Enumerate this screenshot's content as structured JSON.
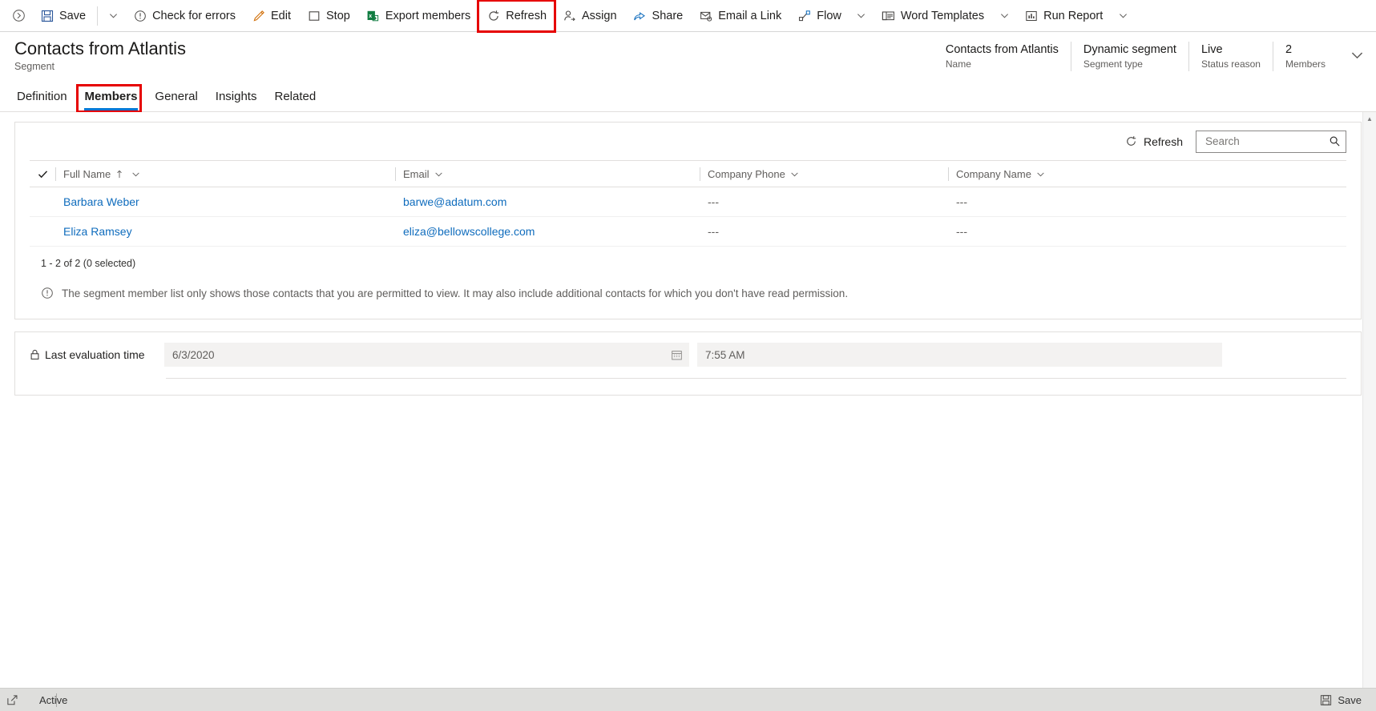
{
  "commandbar": {
    "expand_icon": "chevron-right-circle-icon",
    "items": [
      {
        "label": "Save",
        "icon": "save-icon",
        "caret": true
      },
      {
        "label": "Check for errors",
        "icon": "error-circle-icon",
        "caret": false
      },
      {
        "label": "Edit",
        "icon": "pencil-icon",
        "caret": false
      },
      {
        "label": "Stop",
        "icon": "stop-square-icon",
        "caret": false
      },
      {
        "label": "Export members",
        "icon": "excel-icon",
        "caret": false
      },
      {
        "label": "Refresh",
        "icon": "refresh-icon",
        "caret": false,
        "highlighted": true
      },
      {
        "label": "Assign",
        "icon": "assign-person-icon",
        "caret": false
      },
      {
        "label": "Share",
        "icon": "share-icon",
        "caret": false
      },
      {
        "label": "Email a Link",
        "icon": "email-link-icon",
        "caret": false
      },
      {
        "label": "Flow",
        "icon": "flow-icon",
        "caret": true
      },
      {
        "label": "Word Templates",
        "icon": "word-template-icon",
        "caret": true
      },
      {
        "label": "Run Report",
        "icon": "run-report-icon",
        "caret": true
      }
    ]
  },
  "record": {
    "title": "Contacts from Atlantis",
    "subtitle": "Segment",
    "fields": [
      {
        "value": "Contacts from Atlantis",
        "label": "Name"
      },
      {
        "value": "Dynamic segment",
        "label": "Segment type"
      },
      {
        "value": "Live",
        "label": "Status reason"
      },
      {
        "value": "2",
        "label": "Members"
      }
    ],
    "chevron_icon": "chevron-down-icon"
  },
  "tabs": [
    {
      "label": "Definition",
      "selected": false
    },
    {
      "label": "Members",
      "selected": true,
      "highlighted": true
    },
    {
      "label": "General",
      "selected": false
    },
    {
      "label": "Insights",
      "selected": false
    },
    {
      "label": "Related",
      "selected": false
    }
  ],
  "grid": {
    "refresh_label": "Refresh",
    "refresh_icon": "refresh-icon",
    "search_placeholder": "Search",
    "search_value": "",
    "search_icon": "search-icon",
    "select_all_icon": "checkmark-icon",
    "columns": [
      {
        "label": "Full Name",
        "sorted": true,
        "sort_icon": "sort-ascending-arrow-icon"
      },
      {
        "label": "Email",
        "sorted": false
      },
      {
        "label": "Company Phone",
        "sorted": false
      },
      {
        "label": "Company Name",
        "sorted": false
      }
    ],
    "rows": [
      {
        "full_name": "Barbara Weber",
        "email": "barwe@adatum.com",
        "company_phone": "---",
        "company_name": "---"
      },
      {
        "full_name": "Eliza Ramsey",
        "email": "eliza@bellowscollege.com",
        "company_phone": "---",
        "company_name": "---"
      }
    ],
    "footer_count": "1 - 2 of 2 (0 selected)",
    "note_icon": "info-circle-icon",
    "note": "The segment member list only shows those contacts that you are permitted to view. It may also include additional contacts for which you don't have read permission."
  },
  "evaluation": {
    "lock_icon": "lock-icon",
    "label": "Last evaluation time",
    "date_value": "6/3/2020",
    "calendar_icon": "calendar-icon",
    "time_value": "7:55 AM"
  },
  "statusbar": {
    "expand_icon": "popout-icon",
    "status": "Active",
    "save_label": "Save",
    "save_icon": "save-icon"
  },
  "colors": {
    "accent": "#0078d4",
    "link": "#0f6cbd",
    "highlight": "#e60000",
    "statusbar_bg": "#dededc"
  }
}
